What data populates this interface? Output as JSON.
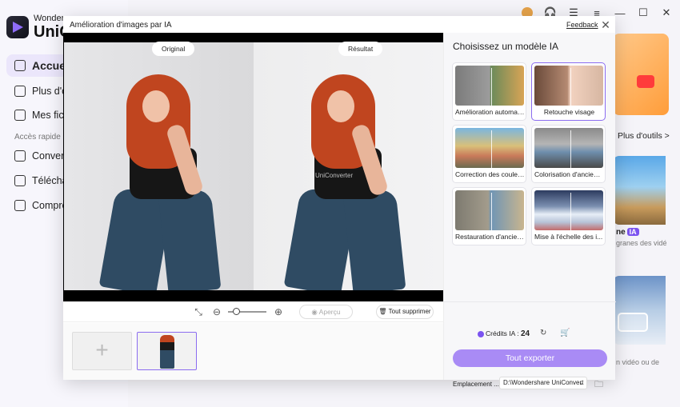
{
  "app": {
    "logo_top": "Wonders",
    "logo_bottom": "UniCo",
    "topbar_icons": [
      "avatar-icon",
      "headset-icon",
      "menu-icon",
      "minimize-icon",
      "maximize-icon",
      "close-icon"
    ]
  },
  "sidebar": {
    "items": [
      {
        "label": "Accueil",
        "active": true
      },
      {
        "label": "Plus d'ou"
      },
      {
        "label": "Mes fichi"
      }
    ],
    "section_label": "Accès rapide",
    "quick": [
      {
        "label": "Converti"
      },
      {
        "label": "Téléchar"
      },
      {
        "label": "Compres"
      }
    ]
  },
  "background": {
    "more_tools": "Plus d'outils >",
    "card1_title": "ne",
    "card1_badge": "IA",
    "card1_sub": "granes des vidé",
    "card2_sub": "n vidéo ou de"
  },
  "modal": {
    "title": "Amélioration d'images par IA",
    "feedback": "Feedback",
    "close_glyph": "✕",
    "original_label": "Original",
    "result_label": "Résultat",
    "watermark": "UniConverter",
    "toolbar": {
      "fit_glyph": "⤡",
      "zoom_out_glyph": "⊖",
      "zoom_in_glyph": "⊕",
      "zoom_level": 0.2,
      "preview_label": "◉ Aperçu",
      "clear_label": "🗑 Tout supprimer"
    },
    "add_glyph": "+"
  },
  "panel": {
    "title": "Choisissez un modèle IA",
    "models": [
      {
        "label": "Amélioration automat...",
        "selected": false
      },
      {
        "label": "Retouche visage",
        "selected": true
      },
      {
        "label": "Correction des couleurs",
        "selected": false
      },
      {
        "label": "Colorisation d'ancienn...",
        "selected": false
      },
      {
        "label": "Restauration d'ancien...",
        "selected": false
      },
      {
        "label": "Mise à l'échelle des i...",
        "selected": false
      }
    ],
    "credits_label": "Crédits IA : ",
    "credits_value": "24",
    "export_label": "Tout exporter",
    "location_label": "Emplacement ...",
    "location_value": "D:\\Wondershare UniConvert",
    "accent_color": "#8b6cf0",
    "button_color": "#a98bf5"
  }
}
